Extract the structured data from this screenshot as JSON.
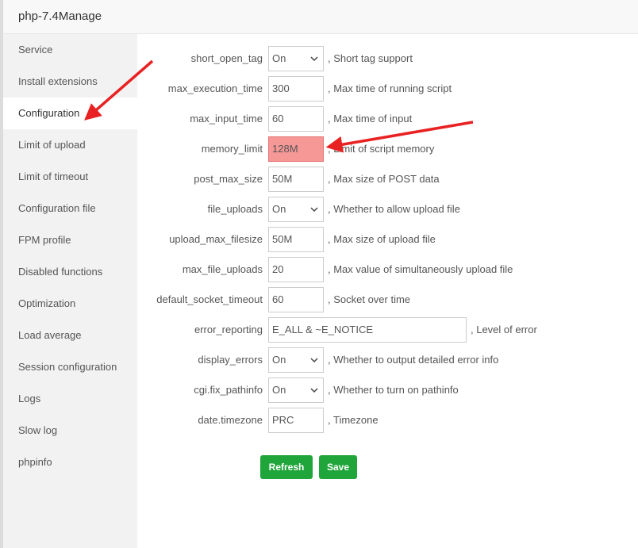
{
  "window": {
    "title": "php-7.4Manage"
  },
  "sidebar": {
    "items": [
      {
        "label": "Service"
      },
      {
        "label": "Install extensions"
      },
      {
        "label": "Configuration",
        "active": true
      },
      {
        "label": "Limit of upload"
      },
      {
        "label": "Limit of timeout"
      },
      {
        "label": "Configuration file"
      },
      {
        "label": "FPM profile"
      },
      {
        "label": "Disabled functions"
      },
      {
        "label": "Optimization"
      },
      {
        "label": "Load average"
      },
      {
        "label": "Session configuration"
      },
      {
        "label": "Logs"
      },
      {
        "label": "Slow log"
      },
      {
        "label": "phpinfo"
      }
    ]
  },
  "settings": [
    {
      "name": "short_open_tag",
      "type": "select",
      "value": "On",
      "desc": ", Short tag support"
    },
    {
      "name": "max_execution_time",
      "type": "input",
      "value": "300",
      "desc": ", Max time of running script"
    },
    {
      "name": "max_input_time",
      "type": "input",
      "value": "60",
      "desc": ", Max time of input"
    },
    {
      "name": "memory_limit",
      "type": "input",
      "value": "128M",
      "desc": ", Limit of script memory",
      "highlighted": true
    },
    {
      "name": "post_max_size",
      "type": "input",
      "value": "50M",
      "desc": ", Max size of POST data"
    },
    {
      "name": "file_uploads",
      "type": "select",
      "value": "On",
      "desc": ", Whether to allow upload file"
    },
    {
      "name": "upload_max_filesize",
      "type": "input",
      "value": "50M",
      "desc": ", Max size of upload file"
    },
    {
      "name": "max_file_uploads",
      "type": "input",
      "value": "20",
      "desc": ", Max value of simultaneously upload file"
    },
    {
      "name": "default_socket_timeout",
      "type": "input",
      "value": "60",
      "desc": ", Socket over time"
    },
    {
      "name": "error_reporting",
      "type": "input-wide",
      "value": "E_ALL & ~E_NOTICE",
      "desc": ", Level of error"
    },
    {
      "name": "display_errors",
      "type": "select",
      "value": "On",
      "desc": ", Whether to output detailed error info"
    },
    {
      "name": "cgi.fix_pathinfo",
      "type": "select",
      "value": "On",
      "desc": ", Whether to turn on pathinfo"
    },
    {
      "name": "date.timezone",
      "type": "input",
      "value": "PRC",
      "desc": ", Timezone"
    }
  ],
  "buttons": {
    "refresh": "Refresh",
    "save": "Save"
  },
  "colors": {
    "accent_green": "#20a53a",
    "highlight_red": "#f59896",
    "annotation_arrow": "#e82222"
  }
}
